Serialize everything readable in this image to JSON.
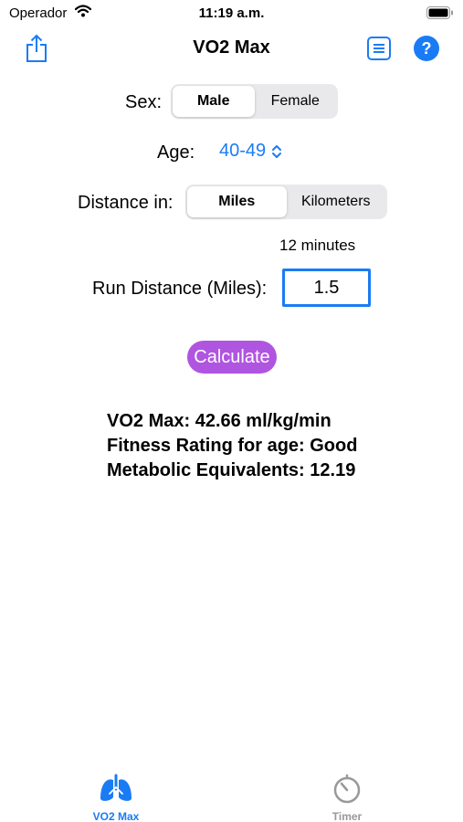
{
  "status_bar": {
    "carrier": "Operador",
    "time": "11:19 a.m."
  },
  "nav": {
    "title": "VO2 Max"
  },
  "sex": {
    "label": "Sex:",
    "options": [
      "Male",
      "Female"
    ],
    "selected": "Male"
  },
  "age": {
    "label": "Age:",
    "value": "40-49"
  },
  "distance_unit": {
    "label": "Distance in:",
    "options": [
      "Miles",
      "Kilometers"
    ],
    "selected": "Miles"
  },
  "time_text": "12 minutes",
  "run_distance": {
    "label": "Run Distance (Miles):",
    "value": "1.5"
  },
  "calculate_label": "Calculate",
  "results": {
    "vo2": "VO2 Max: 42.66 ml/kg/min",
    "rating": "Fitness Rating for age: Good",
    "mets": "Metabolic Equivalents: 12.19"
  },
  "tabs": [
    {
      "label": "VO2 Max",
      "icon": "lungs-icon",
      "active": true
    },
    {
      "label": "Timer",
      "icon": "timer-icon",
      "active": false
    }
  ],
  "colors": {
    "accent": "#1a7cf5",
    "calculate": "#b055e0",
    "inactive_tab": "#999999"
  }
}
